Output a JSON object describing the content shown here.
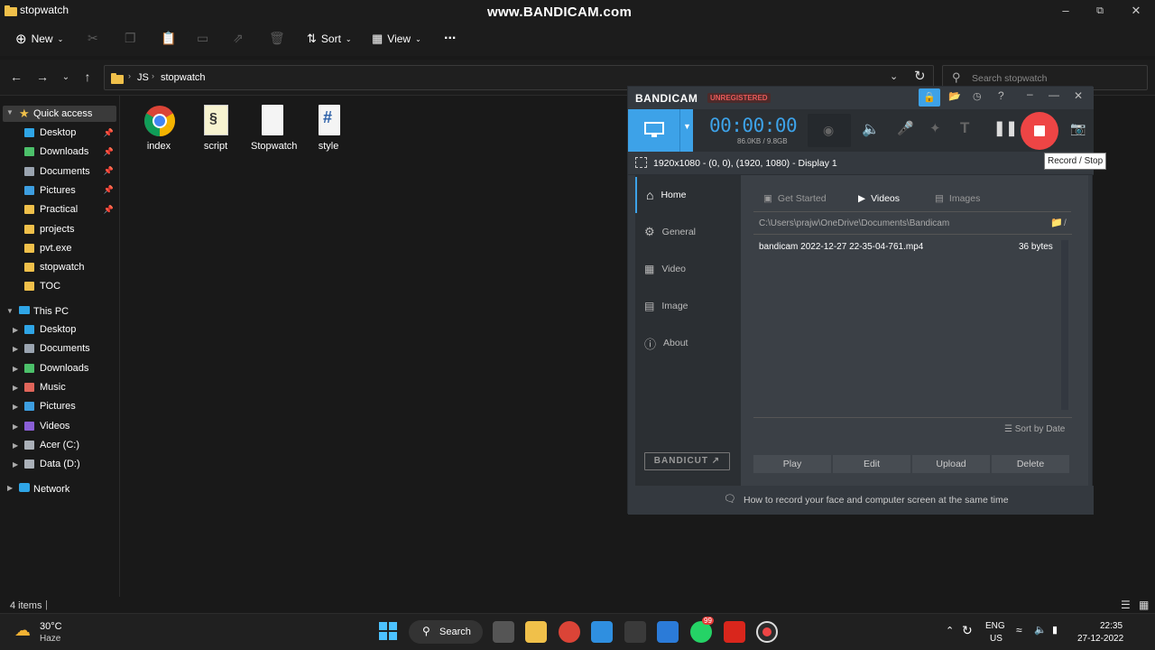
{
  "watermark": "www.BANDICAM.com",
  "explorer": {
    "title": "stopwatch",
    "toolbar": {
      "new": "New",
      "sort": "Sort",
      "view": "View",
      "more": "..."
    },
    "breadcrumb": [
      "JS",
      "stopwatch"
    ],
    "search_placeholder": "Search stopwatch",
    "quick_access": {
      "label": "Quick access",
      "items": [
        {
          "label": "Desktop",
          "icon": "desktop-icon",
          "color": "#2fa5e6",
          "pinned": true
        },
        {
          "label": "Downloads",
          "icon": "download-icon",
          "color": "#4cc06a",
          "pinned": true
        },
        {
          "label": "Documents",
          "icon": "documents-icon",
          "color": "#9aa4b0",
          "pinned": true
        },
        {
          "label": "Pictures",
          "icon": "pictures-icon",
          "color": "#3d9ee0",
          "pinned": true
        },
        {
          "label": "Practical",
          "icon": "folder-icon",
          "color": "#f0c04a",
          "pinned": true
        },
        {
          "label": "projects",
          "icon": "folder-icon",
          "color": "#f0c04a",
          "pinned": false
        },
        {
          "label": "pvt.exe",
          "icon": "folder-icon",
          "color": "#f0c04a",
          "pinned": false
        },
        {
          "label": "stopwatch",
          "icon": "folder-icon",
          "color": "#f0c04a",
          "pinned": false
        },
        {
          "label": "TOC",
          "icon": "folder-icon",
          "color": "#f0c04a",
          "pinned": false
        }
      ]
    },
    "this_pc": {
      "label": "This PC",
      "items": [
        {
          "label": "Desktop",
          "icon": "desktop-icon",
          "color": "#2fa5e6"
        },
        {
          "label": "Documents",
          "icon": "documents-icon",
          "color": "#9aa4b0"
        },
        {
          "label": "Downloads",
          "icon": "download-icon",
          "color": "#4cc06a"
        },
        {
          "label": "Music",
          "icon": "music-icon",
          "color": "#e0655a"
        },
        {
          "label": "Pictures",
          "icon": "pictures-icon",
          "color": "#3d9ee0"
        },
        {
          "label": "Videos",
          "icon": "videos-icon",
          "color": "#8a5fd6"
        },
        {
          "label": "Acer (C:)",
          "icon": "drive-icon",
          "color": "#aab0b8"
        },
        {
          "label": "Data (D:)",
          "icon": "drive-icon",
          "color": "#aab0b8"
        }
      ]
    },
    "network": "Network",
    "files": [
      {
        "label": "index",
        "icon": "chrome-icon"
      },
      {
        "label": "script",
        "icon": "script-icon"
      },
      {
        "label": "Stopwatch",
        "icon": "blank-file-icon"
      },
      {
        "label": "style",
        "icon": "css-file-icon"
      }
    ],
    "status": "4 items"
  },
  "bandicam": {
    "logo": "BANDICAM",
    "unregistered": "UNREGISTERED",
    "timer": "00:00:00",
    "size": "86.0KB / 9.8GB",
    "tooltip": "Record / Stop",
    "resolution": "1920x1080 - (0, 0), (1920, 1080) - Display 1",
    "nav": [
      "Home",
      "General",
      "Video",
      "Image",
      "About"
    ],
    "tabs": [
      "Get Started",
      "Videos",
      "Images"
    ],
    "path": "C:\\Users\\prajw\\OneDrive\\Documents\\Bandicam",
    "path_suffix": "/",
    "file": {
      "name": "bandicam 2022-12-27 22-35-04-761.mp4",
      "size": "36 bytes"
    },
    "sort": "Sort by Date",
    "bandicut": "BANDICUT",
    "buttons": [
      "Play",
      "Edit",
      "Upload",
      "Delete"
    ],
    "footer": "How to record your face and computer screen at the same time",
    "accent": "#3da2e8",
    "record_color": "#ee4545"
  },
  "taskbar": {
    "weather_temp": "30°C",
    "weather_text": "Haze",
    "search": "Search",
    "whatsapp_badge": "99",
    "lang1": "ENG",
    "lang2": "US",
    "time": "22:35",
    "date": "27-12-2022"
  }
}
